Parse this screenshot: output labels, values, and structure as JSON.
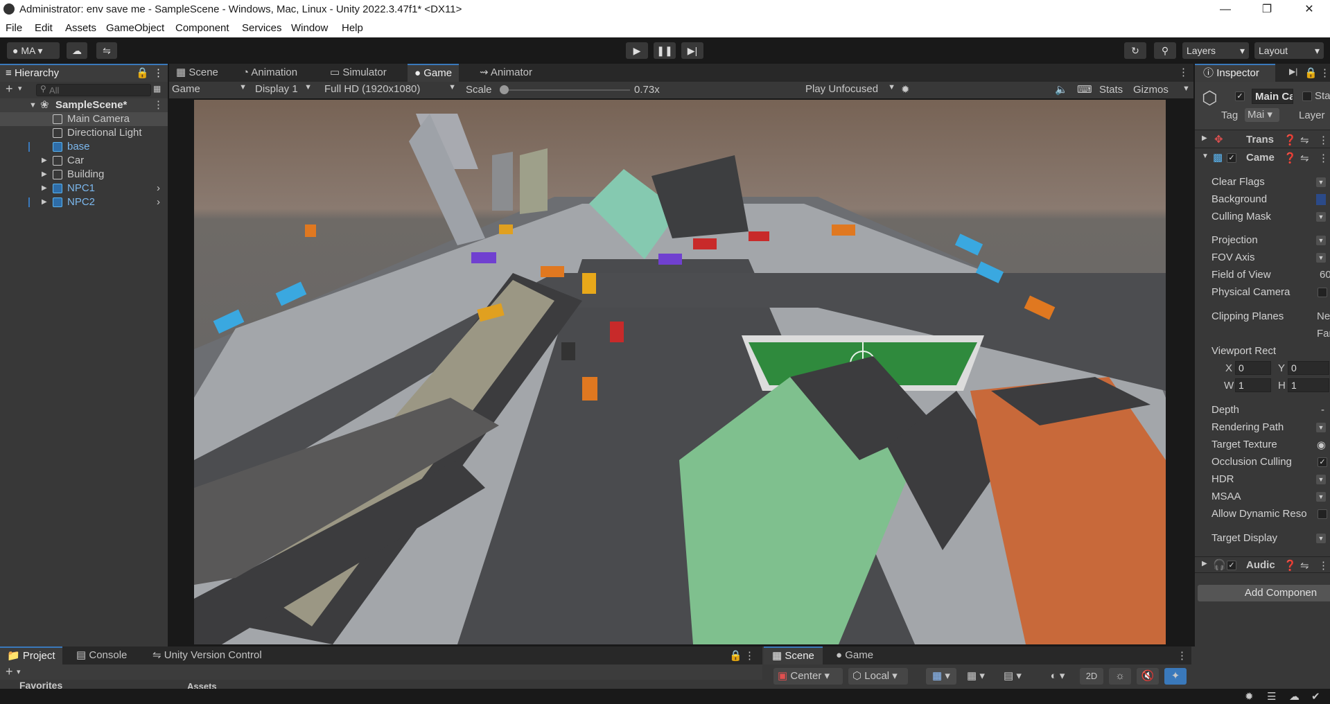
{
  "window": {
    "title": "Administrator: env save me - SampleScene - Windows, Mac, Linux - Unity 2022.3.47f1* <DX11>"
  },
  "menu": [
    "File",
    "Edit",
    "Assets",
    "GameObject",
    "Component",
    "Services",
    "Window",
    "Help"
  ],
  "toolbar": {
    "account": "MA",
    "layers": "Layers",
    "layout": "Layout"
  },
  "hierarchy": {
    "tab": "Hierarchy",
    "search_placeholder": "All",
    "scene": "SampleScene*",
    "items": [
      "Main Camera",
      "Directional Light",
      "base",
      "Car",
      "Building",
      "NPC1",
      "NPC2"
    ]
  },
  "center_tabs": [
    "Scene",
    "Animation",
    "Simulator",
    "Game",
    "Animator"
  ],
  "game_bar": {
    "mode": "Game",
    "display": "Display 1",
    "resolution": "Full HD (1920x1080)",
    "scale_label": "Scale",
    "scale_value": "0.73x",
    "play_mode": "Play Unfocused",
    "stats": "Stats",
    "gizmos": "Gizmos"
  },
  "inspector": {
    "tab": "Inspector",
    "object_name": "Main Ca",
    "static_label": "Sta",
    "tag_label": "Tag",
    "tag_value": "Mai",
    "layer_label": "Layer",
    "components": [
      "Trans",
      "Came",
      "Audic"
    ],
    "props": [
      "Clear Flags",
      "Background",
      "Culling Mask",
      "Projection",
      "FOV Axis",
      "Field of View",
      "Physical Camera",
      "Clipping Planes",
      "Viewport Rect",
      "Depth",
      "Rendering Path",
      "Target Texture",
      "Occlusion Culling",
      "HDR",
      "MSAA",
      "Allow Dynamic Reso",
      "Target Display"
    ],
    "fov_value": "60",
    "clip_near": "Ne",
    "clip_far": "Far",
    "vp": {
      "x_label": "X",
      "x": "0",
      "y_label": "Y",
      "y": "0",
      "w_label": "W",
      "w": "1",
      "h_label": "H",
      "h": "1"
    },
    "depth_value": "-",
    "add_component": "Add Componen"
  },
  "bottom_left_tabs": [
    "Project",
    "Console",
    "Unity Version Control"
  ],
  "favorites": "Favorites",
  "assets_label": "Assets",
  "bottom_right_tabs": [
    "Scene",
    "Game"
  ],
  "scene_tools": {
    "pivot": "Center",
    "space": "Local",
    "mode2d": "2D"
  }
}
